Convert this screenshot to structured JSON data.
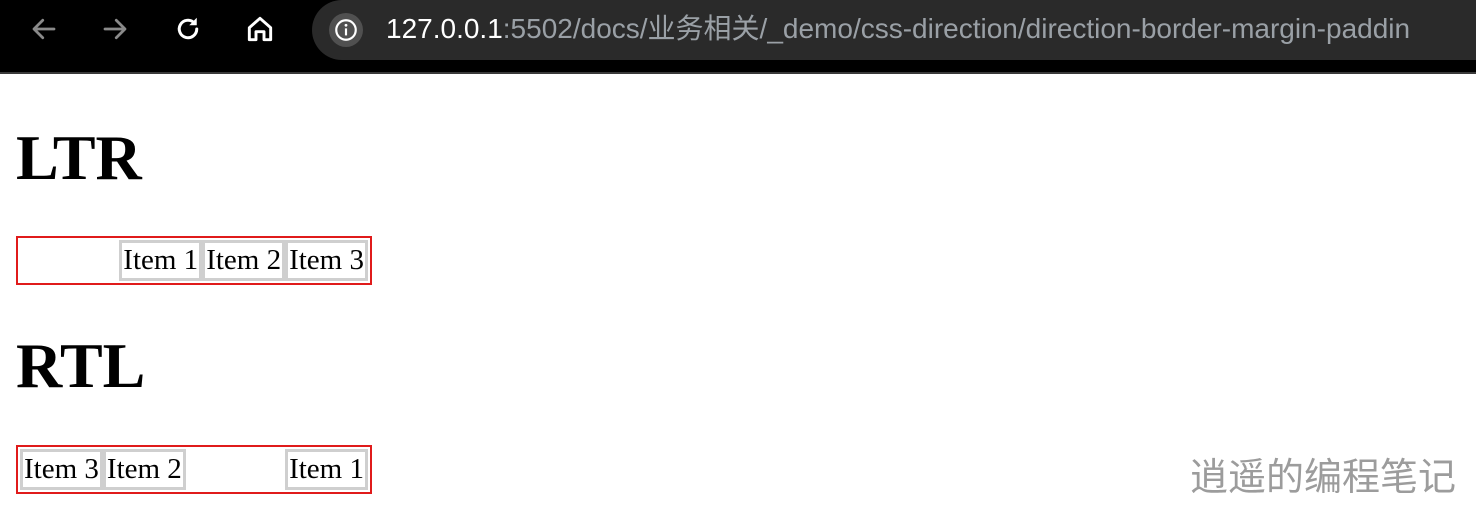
{
  "browser": {
    "url_host": "127.0.0.1",
    "url_rest": ":5502/docs/业务相关/_demo/css-direction/direction-border-margin-paddin"
  },
  "page": {
    "ltr_heading": "LTR",
    "rtl_heading": "RTL",
    "ltr_items": [
      "Item 1",
      "Item 2",
      "Item 3"
    ],
    "rtl_items": [
      "Item 3",
      "Item 2",
      "Item 1"
    ]
  },
  "watermark": "逍遥的编程笔记",
  "colors": {
    "container_border": "#e01b1b",
    "item_border": "#cfcfcf",
    "toolbar_bg": "#000000",
    "omnibox_bg": "#2a2a2a"
  }
}
